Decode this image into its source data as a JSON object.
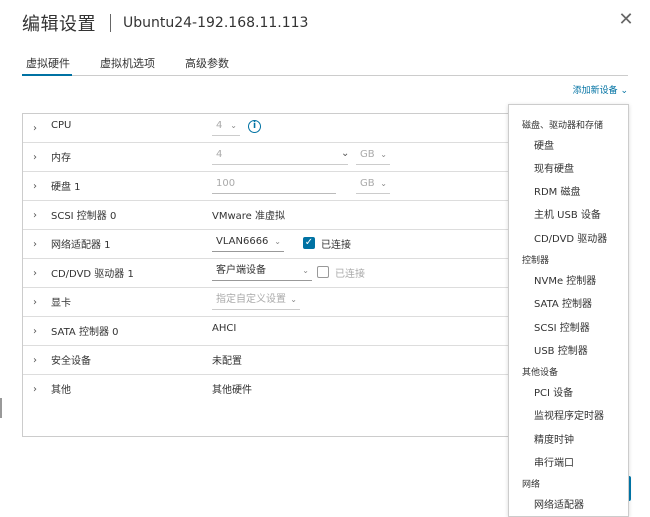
{
  "header": {
    "title": "编辑设置",
    "vm_name": "Ubuntu24-192.168.11.113"
  },
  "tabs": [
    "虚拟硬件",
    "虚拟机选项",
    "高级参数"
  ],
  "add_device": "添加新设备",
  "rows": {
    "cpu": {
      "label": "CPU",
      "value": "4"
    },
    "memory": {
      "label": "内存",
      "value": "4",
      "unit": "GB"
    },
    "disk": {
      "label": "硬盘 1",
      "value": "100",
      "unit": "GB"
    },
    "scsi": {
      "label": "SCSI 控制器 0",
      "value": "VMware 准虚拟"
    },
    "network": {
      "label": "网络适配器 1",
      "value": "VLAN6666",
      "connected": "已连接"
    },
    "cdrom": {
      "label": "CD/DVD 驱动器 1",
      "value": "客户端设备",
      "connected": "已连接"
    },
    "video": {
      "label": "显卡",
      "value": "指定自定义设置"
    },
    "sata": {
      "label": "SATA 控制器 0",
      "value": "AHCI"
    },
    "security": {
      "label": "安全设备",
      "value": "未配置"
    },
    "other": {
      "label": "其他",
      "value": "其他硬件"
    }
  },
  "dropdown": {
    "group1": "磁盘、驱动器和存储",
    "g1_items": [
      "硬盘",
      "现有硬盘",
      "RDM 磁盘",
      "主机 USB 设备",
      "CD/DVD 驱动器"
    ],
    "group2": "控制器",
    "g2_items": [
      "NVMe 控制器",
      "SATA 控制器",
      "SCSI 控制器",
      "USB 控制器"
    ],
    "group3": "其他设备",
    "g3_items": [
      "PCI 设备",
      "监视程序定时器",
      "精度时钟",
      "串行端口"
    ],
    "group4": "网络",
    "g4_items": [
      "网络适配器"
    ]
  }
}
